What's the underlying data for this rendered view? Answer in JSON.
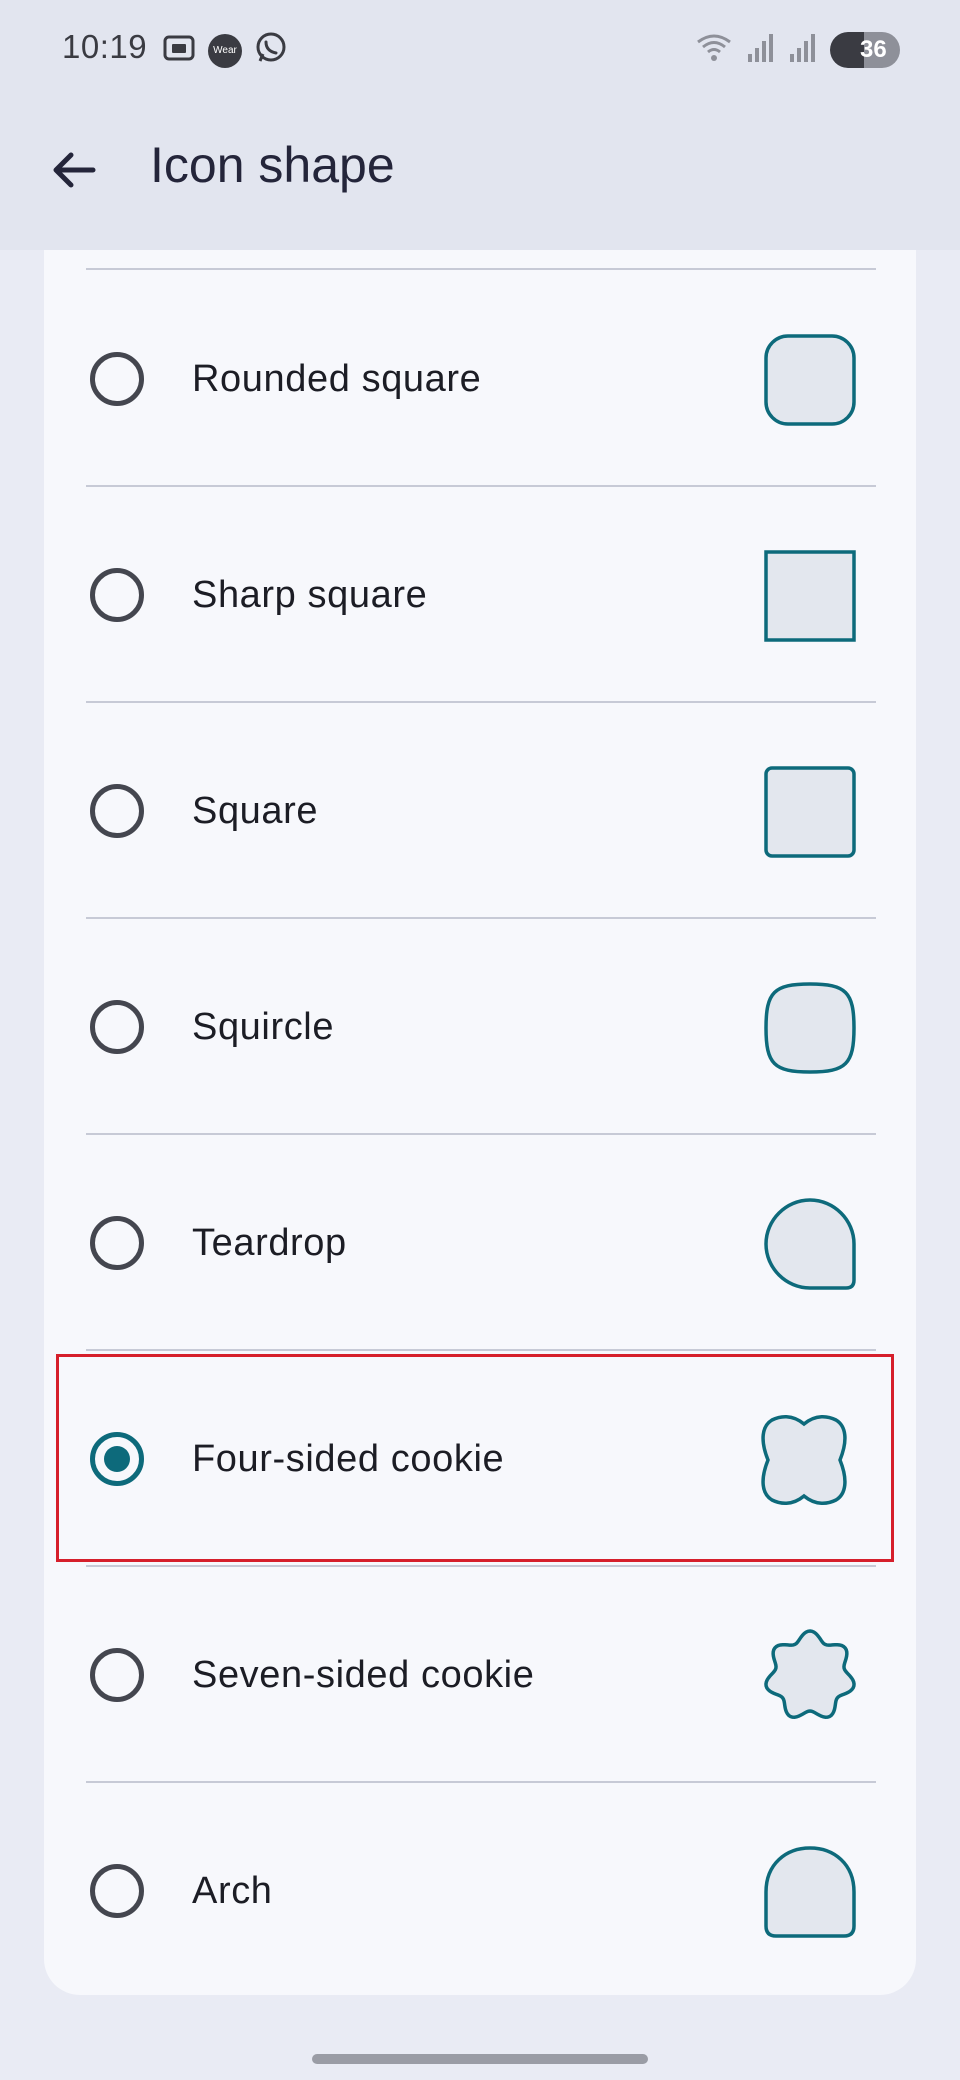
{
  "status": {
    "time": "10:19",
    "badge_text": "Wear",
    "battery": "36",
    "icons": [
      "screenshot-icon",
      "wear-os-icon",
      "whatsapp-icon",
      "wifi-icon",
      "signal-icon",
      "signal-icon-2",
      "battery-icon"
    ]
  },
  "appbar": {
    "title": "Icon shape",
    "back_icon": "arrow-back-icon"
  },
  "options": [
    {
      "label": "Rounded square",
      "selected": false,
      "shape": "rounded-square"
    },
    {
      "label": "Sharp square",
      "selected": false,
      "shape": "sharp-square"
    },
    {
      "label": "Square",
      "selected": false,
      "shape": "square"
    },
    {
      "label": "Squircle",
      "selected": false,
      "shape": "squircle"
    },
    {
      "label": "Teardrop",
      "selected": false,
      "shape": "teardrop"
    },
    {
      "label": "Four-sided cookie",
      "selected": true,
      "shape": "four-sided-cookie"
    },
    {
      "label": "Seven-sided cookie",
      "selected": false,
      "shape": "seven-sided-cookie"
    },
    {
      "label": "Arch",
      "selected": false,
      "shape": "arch"
    }
  ],
  "colors": {
    "accent": "#0d6a7b",
    "shape_fill": "#e3e7ee",
    "highlight": "#d61f2b"
  }
}
